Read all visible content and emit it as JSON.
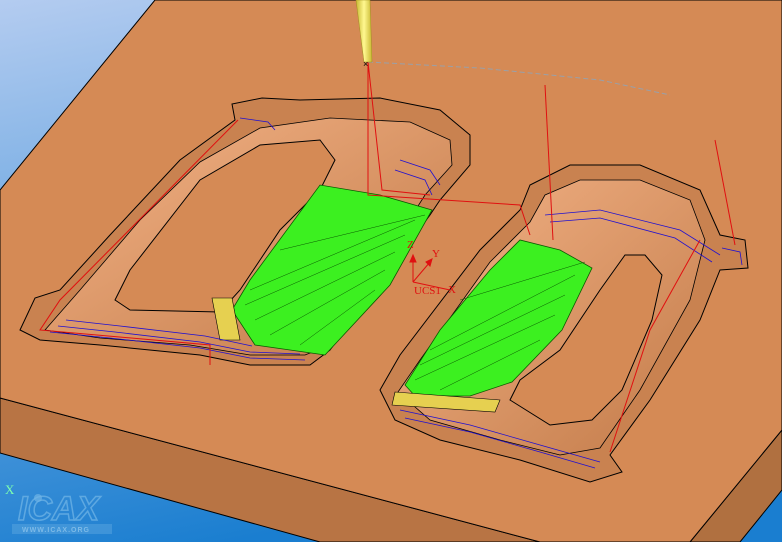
{
  "viewport": {
    "ucs_label": "UCS1",
    "ucs_axes": {
      "x": "X",
      "y": "Y",
      "z": "Z"
    },
    "world_axis_label": "X"
  },
  "watermark": {
    "logo_text": "ICAX",
    "url_text": "WWW.ICAX.ORG"
  },
  "colors": {
    "background_top": "#a8c4ec",
    "background_bottom": "#1e82d0",
    "stock_top": "#d58a55",
    "stock_side": "#b87444",
    "finished_floor": "#3cf020",
    "toolpath_blue": "#2010d0",
    "toolpath_red": "#e01010",
    "tool": "#e8e060"
  }
}
